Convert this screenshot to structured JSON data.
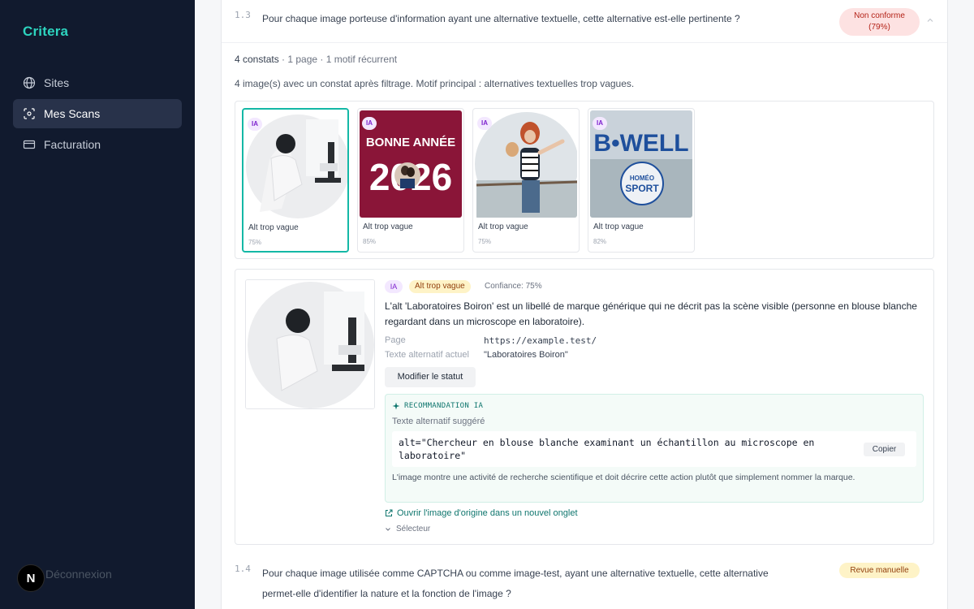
{
  "sidebar": {
    "brand": "Critera",
    "items": [
      {
        "label": "Sites",
        "icon": "globe-icon",
        "active": false
      },
      {
        "label": "Mes Scans",
        "icon": "scan-icon",
        "active": true
      },
      {
        "label": "Facturation",
        "icon": "credit-card-icon",
        "active": false
      }
    ],
    "logout_label": "Déconnexion",
    "avatar_letter": "N"
  },
  "criterion_1_3": {
    "number": "1.3",
    "question": "Pour chaque image porteuse d'information ayant une alternative textuelle, cette alternative est-elle pertinente ?",
    "status_line1": "Non conforme",
    "status_line2": "(79%)",
    "summary_count": "4 constats",
    "summary_rest": " · 1 page · 1 motif récurrent",
    "description": "4 image(s) avec un constat après filtrage. Motif principal : alternatives textuelles trop vagues.",
    "thumbnails": [
      {
        "tag": "IA",
        "label": "Alt trop vague",
        "confidence": "75%"
      },
      {
        "tag": "IA",
        "label": "Alt trop vague",
        "confidence": "85%",
        "image_text_1": "BONNE ANNÉE",
        "image_text_2": "2026"
      },
      {
        "tag": "IA",
        "label": "Alt trop vague",
        "confidence": "75%"
      },
      {
        "tag": "IA",
        "label": "Alt trop vague",
        "confidence": "82%",
        "image_text_1": "B•WELL",
        "image_text_2": "HOMÉO",
        "image_text_3": "SPORT"
      }
    ],
    "detail": {
      "tag_ia": "IA",
      "tag_issue": "Alt trop vague",
      "confidence": "Confiance: 75%",
      "explanation": "L'alt 'Laboratoires Boiron' est un libellé de marque générique qui ne décrit pas la scène visible (personne en blouse blanche regardant dans un microscope en laboratoire).",
      "page_key": "Page",
      "page_value": "https://example.test/",
      "alt_key": "Texte alternatif actuel",
      "alt_value": "\"Laboratoires Boiron\"",
      "status_button": "Modifier le statut",
      "recommendation": {
        "heading": "RECOMMANDATION IA",
        "subheading": "Texte alternatif suggéré",
        "code": "alt=\"Chercheur en blouse blanche examinant un échantillon au microscope en laboratoire\"",
        "copy_button": "Copier",
        "note": "L'image montre une activité de recherche scientifique et doit décrire cette action plutôt que simplement nommer la marque."
      },
      "open_link": "Ouvrir l'image d'origine dans un nouvel onglet",
      "selector_label": "Sélecteur"
    }
  },
  "criterion_1_4": {
    "number": "1.4",
    "question_line1": "Pour chaque image utilisée comme CAPTCHA ou comme image-test, ayant une alternative textuelle, cette alternative",
    "question_line2": "permet-elle d'identifier la nature et la fonction de l'image ?",
    "status": "Revue manuelle"
  },
  "colors": {
    "sidebar_bg": "#111a2e",
    "accent": "#2dd4bf",
    "non_conforme_bg": "#fde2e2",
    "manual_review_bg": "#fef3c7",
    "selected_border": "#14b8a6"
  }
}
